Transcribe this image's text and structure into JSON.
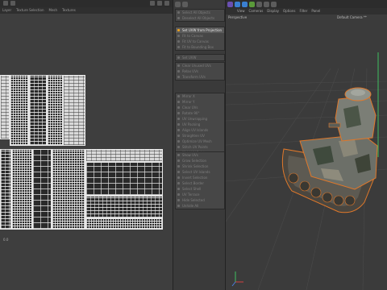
{
  "uv_editor": {
    "menu": [
      "Layer",
      "Texture Selection",
      "Mesh",
      "Textures"
    ],
    "scale_label": "0.0"
  },
  "commands_panel": {
    "groups": [
      {
        "items": [
          {
            "label": "Select All Objects",
            "active": false
          },
          {
            "label": "Deselect All Objects",
            "active": false
          }
        ]
      },
      {
        "items": [
          {
            "label": "Set UVW from Projection",
            "active": true
          },
          {
            "label": "Fit to Canvas",
            "active": false
          },
          {
            "label": "Fit UV to Canvas",
            "active": false
          },
          {
            "label": "Fit to Bounding Box",
            "active": false
          }
        ]
      },
      {
        "items": [
          {
            "label": "Set UVW",
            "active": false
          }
        ]
      },
      {
        "items": [
          {
            "label": "Clear Unused UVs",
            "active": false
          },
          {
            "label": "Relax UVs",
            "active": false
          },
          {
            "label": "Transform UVs",
            "active": false
          }
        ]
      },
      {
        "items": [
          {
            "label": "Mirror X",
            "active": false
          },
          {
            "label": "Mirror Y",
            "active": false
          },
          {
            "label": "Clear UVs",
            "active": false
          },
          {
            "label": "Rotate 90°",
            "active": false
          },
          {
            "label": "UV Unwrapping",
            "active": false
          },
          {
            "label": "UV Packing",
            "active": false
          },
          {
            "label": "Align UV Islands",
            "active": false
          },
          {
            "label": "Straighten UV",
            "active": false
          },
          {
            "label": "Optimize UV Mesh",
            "active": false
          },
          {
            "label": "Stitch UV Points",
            "active": false
          },
          {
            "label": "Weld UV Points",
            "active": false
          }
        ]
      },
      {
        "items": [
          {
            "label": "Show UVs",
            "active": false
          },
          {
            "label": "Grow Selection",
            "active": false
          },
          {
            "label": "Shrink Selection",
            "active": false
          },
          {
            "label": "Select UV Islands",
            "active": false
          },
          {
            "label": "Invert Selection",
            "active": false
          },
          {
            "label": "Select Border",
            "active": false
          },
          {
            "label": "Select Shell",
            "active": false
          },
          {
            "label": "UV Terrace",
            "active": false
          },
          {
            "label": "Hide Selected",
            "active": false
          },
          {
            "label": "Unhide All",
            "active": false
          }
        ]
      }
    ]
  },
  "viewport": {
    "menu": [
      "View",
      "Cameras",
      "Display",
      "Options",
      "Filter",
      "Panel"
    ],
    "view_name": "Perspective",
    "camera_name": "Default Camera **"
  },
  "colors": {
    "accent": "#e8a020",
    "selection_outline": "#e0782a",
    "axis_y": "#3fbf5f",
    "axis_x": "#d04040",
    "axis_z": "#4a7fe0"
  }
}
